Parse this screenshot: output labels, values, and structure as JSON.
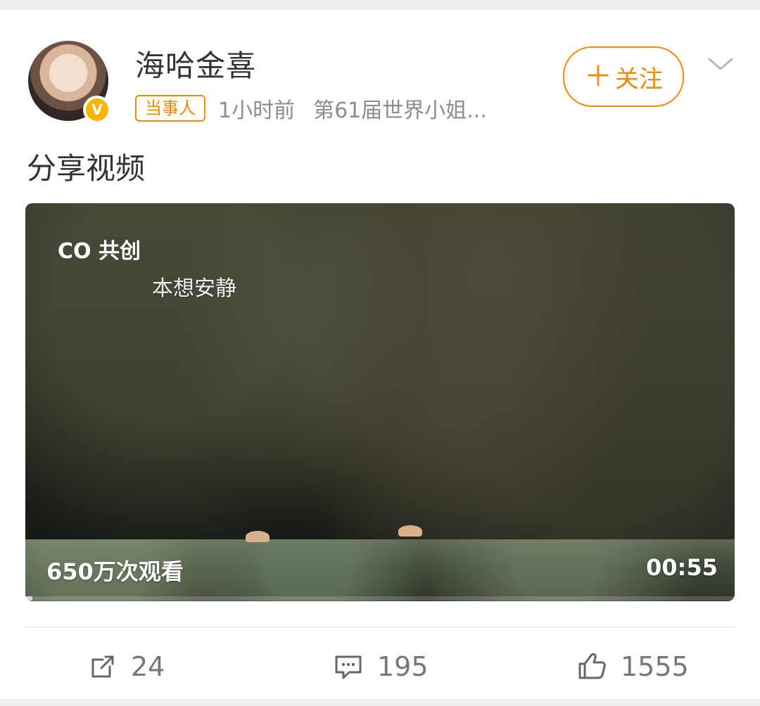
{
  "post": {
    "author": "海哈金喜",
    "tag": "当事人",
    "time": "1小时前",
    "source": "第61届世界小姐...",
    "follow_label": "关注",
    "content": "分享视频"
  },
  "video": {
    "badge": "CO 共创",
    "subtitle": "本想安静",
    "views": "650万次观看",
    "duration": "00:55",
    "progress": 0.01
  },
  "actions": {
    "share_count": "24",
    "comment_count": "195",
    "like_count": "1555"
  },
  "colors": {
    "accent": "#f28a00",
    "text": "#333333",
    "muted": "#8c8c8c"
  },
  "icons": {
    "avatar": "avatar",
    "verified": "verified-badge-icon",
    "follow_plus": "plus-icon",
    "more": "chevron-down-icon",
    "share": "share-icon",
    "comment": "comment-icon",
    "like": "like-icon"
  }
}
